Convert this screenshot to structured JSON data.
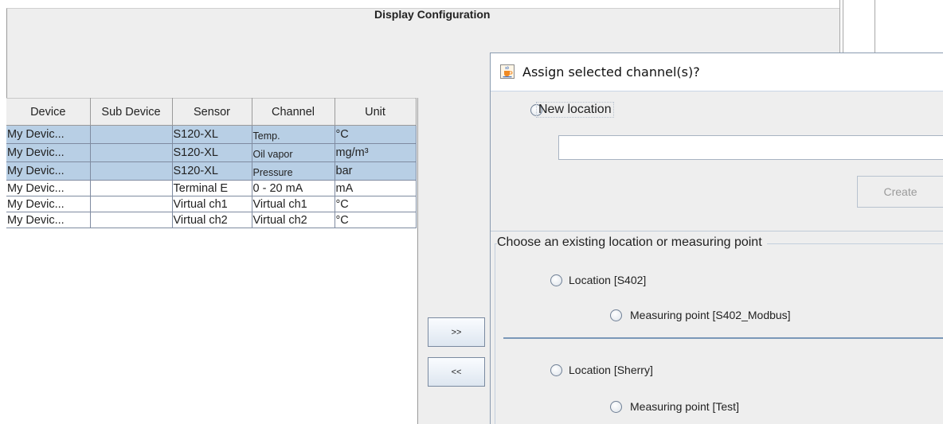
{
  "main": {
    "title": "Display Configuration"
  },
  "table": {
    "columns": [
      "Device",
      "Sub Device",
      "Sensor",
      "Channel",
      "Unit"
    ],
    "rows": [
      {
        "device": "My Devic...",
        "sub": "",
        "sensor": "S120-XL",
        "channel": "Temp.",
        "unit": "°C",
        "selected": true
      },
      {
        "device": "My Devic...",
        "sub": "",
        "sensor": "S120-XL",
        "channel": "Oil vapor",
        "unit": "mg/m³",
        "selected": true
      },
      {
        "device": "My Devic...",
        "sub": "",
        "sensor": "S120-XL",
        "channel": "Pressure",
        "unit": "bar",
        "selected": true
      },
      {
        "device": "My Devic...",
        "sub": "",
        "sensor": "Terminal E",
        "channel": "0 - 20 mA",
        "unit": "mA",
        "selected": false
      },
      {
        "device": "My Devic...",
        "sub": "",
        "sensor": "Virtual ch1",
        "channel": "Virtual ch1",
        "unit": "°C",
        "selected": false
      },
      {
        "device": "My Devic...",
        "sub": "",
        "sensor": "Virtual ch2",
        "channel": "Virtual ch2",
        "unit": "°C",
        "selected": false
      }
    ]
  },
  "buttons": {
    "add": ">>",
    "remove": "<<"
  },
  "dialog": {
    "title": "Assign selected channel(s)?",
    "new_location_label": "New location",
    "new_location_value": "",
    "create_label": "Create",
    "group_title": "Choose an existing location or measuring point",
    "options": [
      {
        "label": "Location [S402]"
      },
      {
        "label": "Measuring point [S402_Modbus]"
      },
      {
        "label": "Location [Sherry]"
      },
      {
        "label": "Measuring point [Test]"
      }
    ]
  },
  "colors": {
    "selection": "#b8cfe5",
    "panel": "#eeeeee",
    "divider": "#7a98b8"
  },
  "icons": {
    "dialog_icon": "java-coffee-cup-icon"
  }
}
